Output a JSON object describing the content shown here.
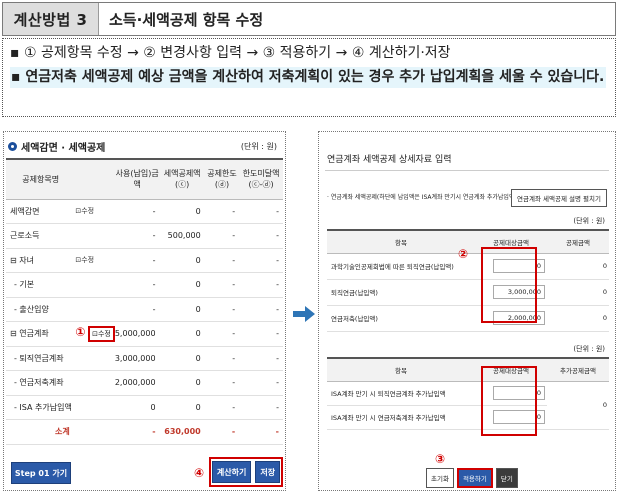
{
  "header": {
    "method": "계산방법 3",
    "title": "소득·세액공제 항목 수정"
  },
  "steps": {
    "line1": "▪ ① 공제항목 수정 → ② 변경사항 입력 → ③ 적용하기 → ④ 계산하기·저장",
    "line2": "▪ 연금저축 세액공제 예상 금액을 계산하여 저축계획이 있는 경우 추가 납입계획을 세울 수 있습니다."
  },
  "left_panel": {
    "title": "세액감면 · 세액공제",
    "unit": "(단위 : 원)",
    "headers": [
      "공제항목명",
      "",
      "사용(납입)금액",
      "세액공제액 (ⓒ)",
      "공제한도 (ⓓ)",
      "한도미달액 (ⓒ-ⓓ)"
    ],
    "rows": [
      {
        "name": "세액감면",
        "edit": "⊡수정",
        "amount": "-",
        "credit": "0",
        "limit": "-",
        "short": "-"
      },
      {
        "name": "근로소득",
        "edit": "",
        "amount": "-",
        "credit": "500,000",
        "limit": "-",
        "short": "-"
      },
      {
        "name": "⊟ 자녀",
        "edit": "⊡수정",
        "amount": "-",
        "credit": "0",
        "limit": "-",
        "short": "-"
      },
      {
        "name": "- 기본",
        "edit": "",
        "amount": "-",
        "credit": "0",
        "limit": "-",
        "short": "-"
      },
      {
        "name": "- 출산입양",
        "edit": "",
        "amount": "-",
        "credit": "0",
        "limit": "-",
        "short": "-"
      },
      {
        "name": "⊟ 연금계좌",
        "edit": "⊡수정",
        "amount": "5,000,000",
        "credit": "0",
        "limit": "-",
        "short": "-"
      },
      {
        "name": "- 퇴직연금계좌",
        "edit": "",
        "amount": "3,000,000",
        "credit": "0",
        "limit": "-",
        "short": "-"
      },
      {
        "name": "- 연금저축계좌",
        "edit": "",
        "amount": "2,000,000",
        "credit": "0",
        "limit": "-",
        "short": "-"
      },
      {
        "name": "- ISA 추가납입액",
        "edit": "",
        "amount": "0",
        "credit": "0",
        "limit": "-",
        "short": "-"
      }
    ],
    "total": {
      "name": "소계",
      "amount": "-",
      "credit": "630,000",
      "limit": "-",
      "short": "-"
    },
    "step_button": "Step 01 가기",
    "calc_button": "계산하기",
    "save_button": "저장",
    "marker1": "①",
    "marker4": "④"
  },
  "right_panel": {
    "title": "연금계좌 세액공제 상세자료 입력",
    "subtitle": "· 연금계좌 세액공제(하단에 납입액은 ISA계좌 만기시 연금계좌 추가납입액을 미포함)",
    "guide_button": "연금계좌 세액공제 설명 펼치기",
    "unit1": "(단위 : 원)",
    "table1_headers": [
      "항목",
      "공제대상금액",
      "공제금액"
    ],
    "table1_rows": [
      {
        "item": "과학기술인공제회법에 따른 퇴직연금(납입액)",
        "value": "0",
        "deduct": "0"
      },
      {
        "item": "퇴직연금(납입액)",
        "value": "3,000,000",
        "deduct": "0"
      },
      {
        "item": "연금저축(납입액)",
        "value": "2,000,000",
        "deduct": "0"
      }
    ],
    "unit2": "(단위 : 원)",
    "table2_headers": [
      "항목",
      "공제대상금액",
      "추가공제금액"
    ],
    "table2_rows": [
      {
        "item": "ISA계좌 만기 시 퇴직연금계좌 추가납입액",
        "value": "0"
      },
      {
        "item": "ISA계좌 만기 시 연금저축계좌 추가납입액",
        "value": "0"
      }
    ],
    "table2_extra": "0",
    "reset_button": "초기화",
    "apply_button": "적용하기",
    "close_button": "닫기",
    "marker2": "②",
    "marker3": "③"
  },
  "colors": {
    "accent": "#2b5aa8",
    "highlight": "#d00000",
    "note_bg": "#e5f5fb"
  }
}
